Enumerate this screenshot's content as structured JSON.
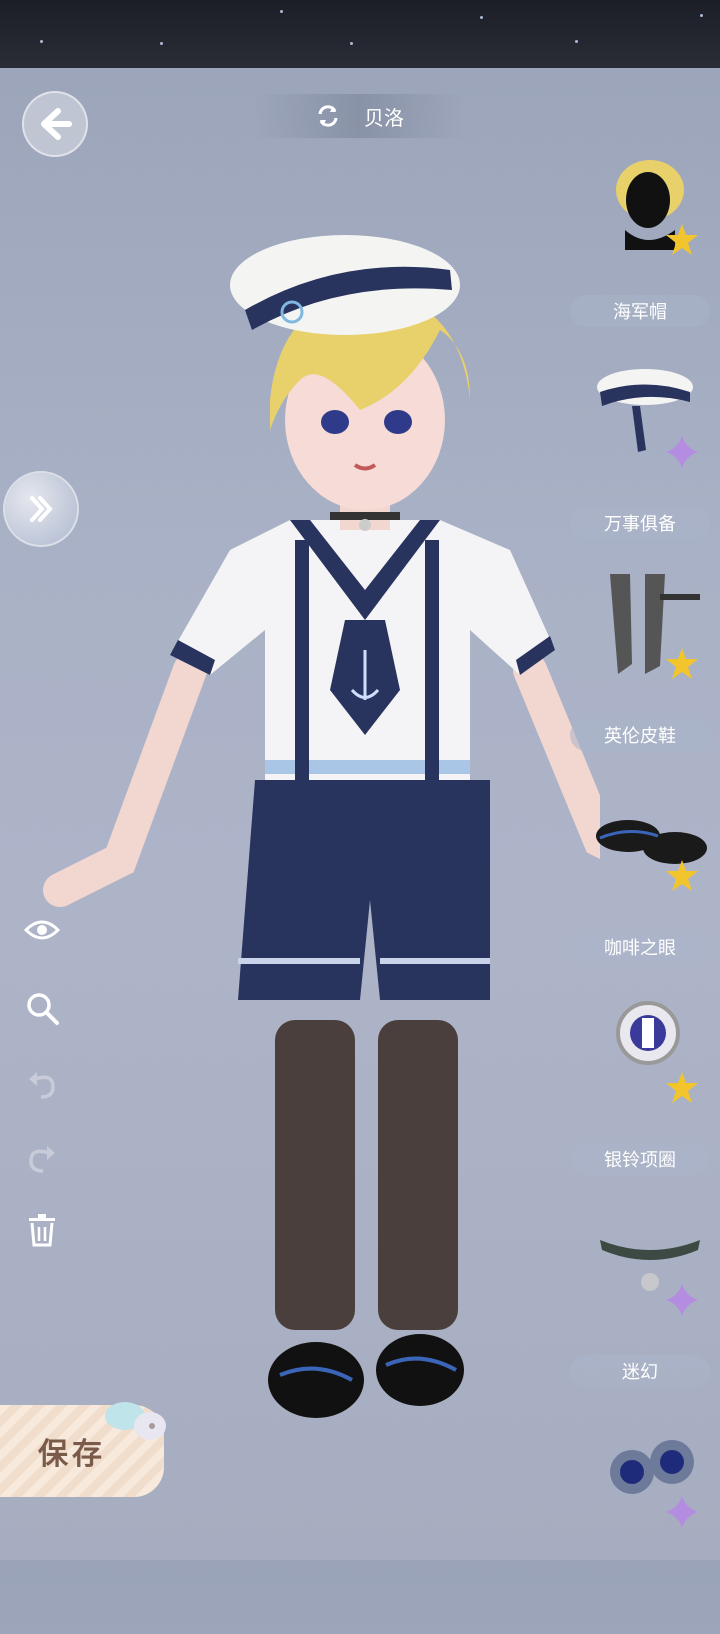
{
  "header": {
    "character_name": "贝洛"
  },
  "left_tools": [
    "eye-icon",
    "zoom-icon",
    "undo-icon",
    "redo-icon",
    "trash-icon"
  ],
  "save": {
    "label": "保存"
  },
  "slots": [
    {
      "label": "海军帽",
      "rarity": "gold",
      "item": "hair"
    },
    {
      "label": "万事俱备",
      "rarity": "purple",
      "item": "hat"
    },
    {
      "label": "英伦皮鞋",
      "rarity": "gold",
      "item": "stockings"
    },
    {
      "label": "咖啡之眼",
      "rarity": "gold",
      "item": "shoes"
    },
    {
      "label": "银铃项圈",
      "rarity": "gold",
      "item": "eye"
    },
    {
      "label": "迷幻",
      "rarity": "purple",
      "item": "collar"
    },
    {
      "label": "",
      "rarity": "purple",
      "item": "eyes"
    }
  ],
  "colors": {
    "gold": "#f3c52c",
    "purple": "#b48de0",
    "navy": "#2a3463"
  }
}
